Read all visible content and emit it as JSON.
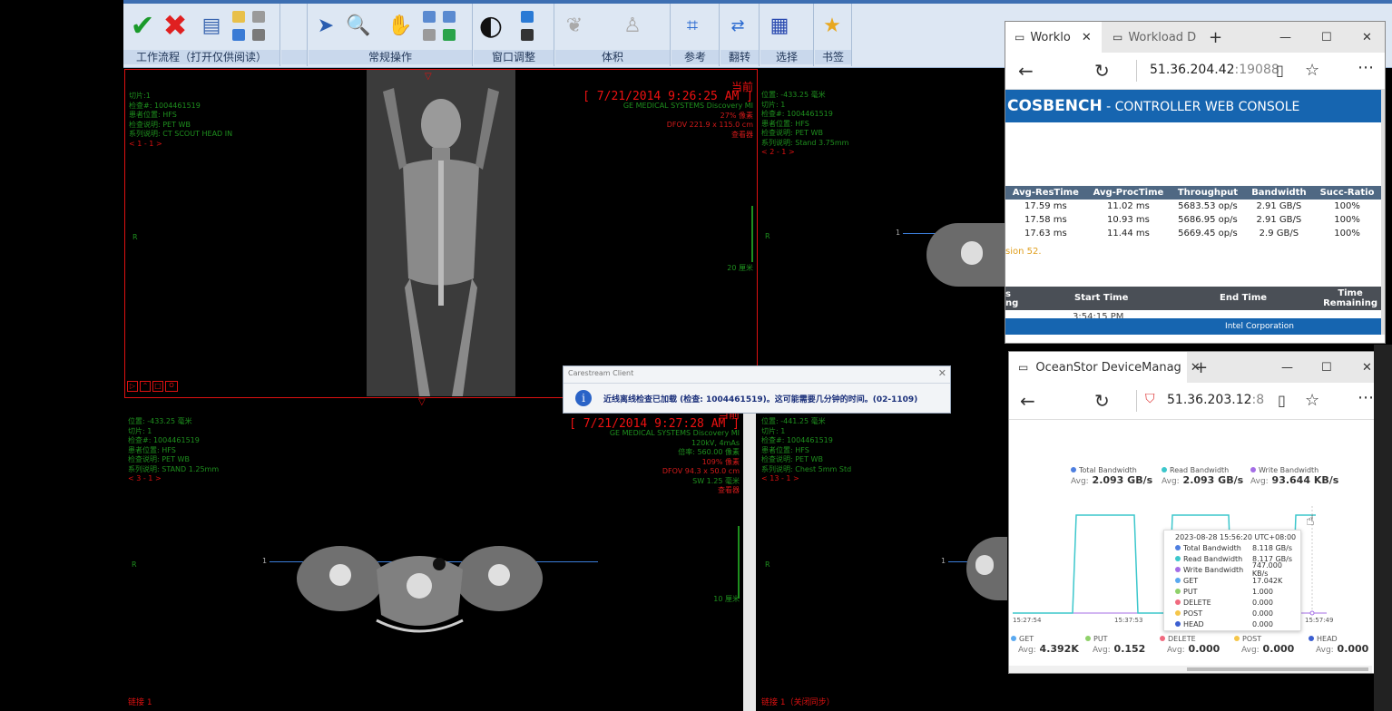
{
  "ribbon": {
    "groups": [
      "工作流程（打开仅供阅读）",
      "常规操作",
      "窗口调整",
      "体积",
      "参考",
      "翻转",
      "选择",
      "书签"
    ]
  },
  "viewports": [
    {
      "id": "vp1",
      "left": [
        "切片:1",
        "检查#: 1004461519",
        "患者位置: HFS",
        "检查说明: PET WB",
        "系列说明: CT SCOUT HEAD IN",
        "< 1 - 1 >"
      ],
      "current": "当前",
      "timestamp": "[ 7/21/2014 9:26:25 AM ]",
      "right": [
        "GE MEDICAL SYSTEMS Discovery MI",
        "27% 像素",
        "DFOV 221.9 x 115.0 cm",
        "查看器"
      ],
      "side_r": "R",
      "scale": "20 厘米"
    },
    {
      "id": "vp2",
      "left": [
        "位置: -433.25 毫米",
        "切片: 1",
        "检查#: 1004461519",
        "患者位置: HFS",
        "检查说明: PET WB",
        "系列说明: Stand 3.75mm",
        "< 2 - 1 >"
      ],
      "side_r": "R",
      "line_num": "1"
    },
    {
      "id": "vp3",
      "left": [
        "位置: -433.25 毫米",
        "切片: 1",
        "检查#: 1004461519",
        "患者位置: HFS",
        "检查说明: PET WB",
        "系列说明: STAND 1.25mm",
        "< 3 - 1 >"
      ],
      "current": "当前",
      "timestamp": "[ 7/21/2014 9:27:28 AM ]",
      "right": [
        "GE MEDICAL SYSTEMS Discovery MI",
        "120kV, 4mAs",
        "倍率: 560.00 像素",
        "109% 像素",
        "DFOV 94.3 x 50.0 cm",
        "SW 1.25 毫米",
        "查看器"
      ],
      "side_r": "R",
      "line_num": "1",
      "scale": "10 厘米",
      "bottom": "链接 1"
    },
    {
      "id": "vp4",
      "left": [
        "位置: -441.25 毫米",
        "切片: 1",
        "检查#: 1004461519",
        "患者位置: HFS",
        "检查说明: PET WB",
        "系列说明: Chest 5mm Std",
        "< 13 - 1 >"
      ],
      "side_r": "R",
      "line_num": "1",
      "bottom": "链接 1（关闭同步）"
    }
  ],
  "dialog": {
    "title": "Carestream Client",
    "message": "近线离线检查已加载 (检查: 1004461519)。这可能需要几分钟的时间。(02-1109)"
  },
  "browser1": {
    "tabs": [
      "Worklo",
      "Workload D"
    ],
    "url_host": "51.36.204.42",
    "url_port": ":19088",
    "page_title": "COSBench - Controller Web Console",
    "title_main": "COSBENCH",
    "title_rest": " - CONTROLLER WEB CONSOLE",
    "columns": [
      "Avg-ResTime",
      "Avg-ProcTime",
      "Throughput",
      "Bandwidth",
      "Succ-Ratio"
    ],
    "rows": [
      [
        "17.59 ms",
        "11.02 ms",
        "5683.53 op/s",
        "2.91 GB/S",
        "100%"
      ],
      [
        "17.58 ms",
        "10.93 ms",
        "5686.95 op/s",
        "2.91 GB/S",
        "100%"
      ],
      [
        "17.63 ms",
        "11.44 ms",
        "5669.45 op/s",
        "2.9 GB/S",
        "100%"
      ]
    ],
    "version_text": "sion 52.",
    "sched_cols": [
      "s\nng",
      "Start Time",
      "End Time",
      "Time\nRemaining"
    ],
    "sched_time": "3:54:15 PM",
    "footer": "Intel Corporation"
  },
  "browser2": {
    "tab": "OceanStor DeviceManag",
    "url_host": "51.36.203.12",
    "url_port": ":8",
    "legend_top": [
      {
        "name": "Total Bandwidth",
        "avg": "2.093 GB/s",
        "color": "#4e7fe0"
      },
      {
        "name": "Read Bandwidth",
        "avg": "2.093 GB/s",
        "color": "#3cc7cc"
      },
      {
        "name": "Write Bandwidth",
        "avg": "93.644 KB/s",
        "color": "#a46ee6"
      }
    ],
    "avg_label": "Avg:",
    "tooltip": {
      "time": "2023-08-28 15:56:20 UTC+08:00",
      "items": [
        {
          "name": "Total Bandwidth",
          "value": "8.118 GB/s",
          "color": "#4e7fe0"
        },
        {
          "name": "Read Bandwidth",
          "value": "8.117 GB/s",
          "color": "#3cc7cc"
        },
        {
          "name": "Write Bandwidth",
          "value": "747.000 KB/s",
          "color": "#a46ee6"
        },
        {
          "name": "GET",
          "value": "17.042K",
          "color": "#5aa9f0"
        },
        {
          "name": "PUT",
          "value": "1.000",
          "color": "#8fd16a"
        },
        {
          "name": "DELETE",
          "value": "0.000",
          "color": "#f06a7f"
        },
        {
          "name": "POST",
          "value": "0.000",
          "color": "#f5c64a"
        },
        {
          "name": "HEAD",
          "value": "0.000",
          "color": "#3c5fd1"
        }
      ]
    },
    "x_ticks": [
      "15:27:54",
      "15:37:53",
      "15:57:49"
    ],
    "legend_bottom": [
      {
        "name": "GET",
        "avg": "4.392K",
        "color": "#5aa9f0"
      },
      {
        "name": "PUT",
        "avg": "0.152",
        "color": "#8fd16a"
      },
      {
        "name": "DELETE",
        "avg": "0.000",
        "color": "#f06a7f"
      },
      {
        "name": "POST",
        "avg": "0.000",
        "color": "#f5c64a"
      },
      {
        "name": "HEAD",
        "avg": "0.000",
        "color": "#3c5fd1"
      }
    ]
  }
}
